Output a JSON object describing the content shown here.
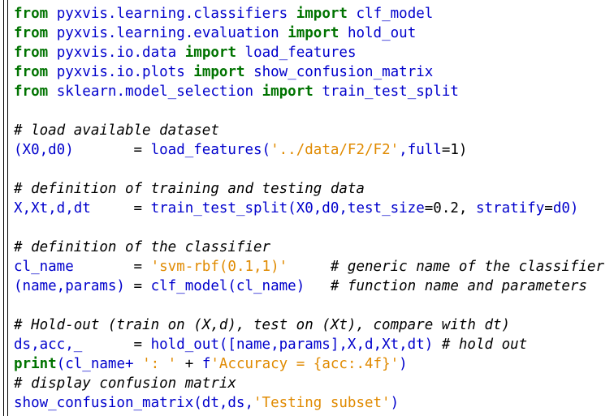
{
  "code": {
    "lines": [
      [
        [
          "kw",
          "from"
        ],
        [
          "tx",
          " "
        ],
        [
          "nm",
          "pyxvis.learning.classifiers"
        ],
        [
          "tx",
          " "
        ],
        [
          "kw",
          "import"
        ],
        [
          "tx",
          " "
        ],
        [
          "nm",
          "clf_model"
        ]
      ],
      [
        [
          "kw",
          "from"
        ],
        [
          "tx",
          " "
        ],
        [
          "nm",
          "pyxvis.learning.evaluation"
        ],
        [
          "tx",
          " "
        ],
        [
          "kw",
          "import"
        ],
        [
          "tx",
          " "
        ],
        [
          "nm",
          "hold_out"
        ]
      ],
      [
        [
          "kw",
          "from"
        ],
        [
          "tx",
          " "
        ],
        [
          "nm",
          "pyxvis.io.data"
        ],
        [
          "tx",
          " "
        ],
        [
          "kw",
          "import"
        ],
        [
          "tx",
          " "
        ],
        [
          "nm",
          "load_features"
        ]
      ],
      [
        [
          "kw",
          "from"
        ],
        [
          "tx",
          " "
        ],
        [
          "nm",
          "pyxvis.io.plots"
        ],
        [
          "tx",
          " "
        ],
        [
          "kw",
          "import"
        ],
        [
          "tx",
          " "
        ],
        [
          "nm",
          "show_confusion_matrix"
        ]
      ],
      [
        [
          "kw",
          "from"
        ],
        [
          "tx",
          " "
        ],
        [
          "nm",
          "sklearn.model_selection"
        ],
        [
          "tx",
          " "
        ],
        [
          "kw",
          "import"
        ],
        [
          "tx",
          " "
        ],
        [
          "nm",
          "train_test_split"
        ]
      ],
      [],
      [
        [
          "cm",
          "# load available dataset"
        ]
      ],
      [
        [
          "nm",
          "(X0,d0)"
        ],
        [
          "tx",
          "       = "
        ],
        [
          "nm",
          "load_features("
        ],
        [
          "st",
          "'../data/F2/F2'"
        ],
        [
          "nm",
          ",full"
        ],
        [
          "tx",
          "=1)"
        ]
      ],
      [],
      [
        [
          "cm",
          "# definition of training and testing data"
        ]
      ],
      [
        [
          "nm",
          "X,Xt,d,dt"
        ],
        [
          "tx",
          "     = "
        ],
        [
          "nm",
          "train_test_split(X0,d0,test_size"
        ],
        [
          "tx",
          "=0.2, "
        ],
        [
          "nm",
          "stratify"
        ],
        [
          "tx",
          "="
        ],
        [
          "nm",
          "d0)"
        ]
      ],
      [],
      [
        [
          "cm",
          "# definition of the classifier"
        ]
      ],
      [
        [
          "nm",
          "cl_name"
        ],
        [
          "tx",
          "       = "
        ],
        [
          "st",
          "'svm-rbf(0.1,1)'"
        ],
        [
          "tx",
          "     "
        ],
        [
          "cm",
          "# generic name of the classifier"
        ]
      ],
      [
        [
          "nm",
          "(name,params)"
        ],
        [
          "tx",
          " = "
        ],
        [
          "nm",
          "clf_model(cl_name)"
        ],
        [
          "tx",
          "   "
        ],
        [
          "cm",
          "# function name and parameters"
        ]
      ],
      [],
      [
        [
          "cm",
          "# Hold-out (train on (X,d), test on (Xt), compare with dt)"
        ]
      ],
      [
        [
          "nm",
          "ds,acc,_"
        ],
        [
          "tx",
          "      = "
        ],
        [
          "nm",
          "hold_out([name,params],X,d,Xt,dt)"
        ],
        [
          "tx",
          " "
        ],
        [
          "cm",
          "# hold out"
        ]
      ],
      [
        [
          "kw",
          "print"
        ],
        [
          "nm",
          "(cl_name+"
        ],
        [
          "tx",
          " "
        ],
        [
          "st",
          "': '"
        ],
        [
          "tx",
          " + "
        ],
        [
          "nm",
          "f"
        ],
        [
          "st",
          "'Accuracy = {acc:.4f}'"
        ],
        [
          "nm",
          ")"
        ]
      ],
      [
        [
          "cm",
          "# display confusion matrix"
        ]
      ],
      [
        [
          "nm",
          "show_confusion_matrix(dt,ds,"
        ],
        [
          "st",
          "'Testing subset'"
        ],
        [
          "nm",
          ")"
        ]
      ]
    ]
  }
}
